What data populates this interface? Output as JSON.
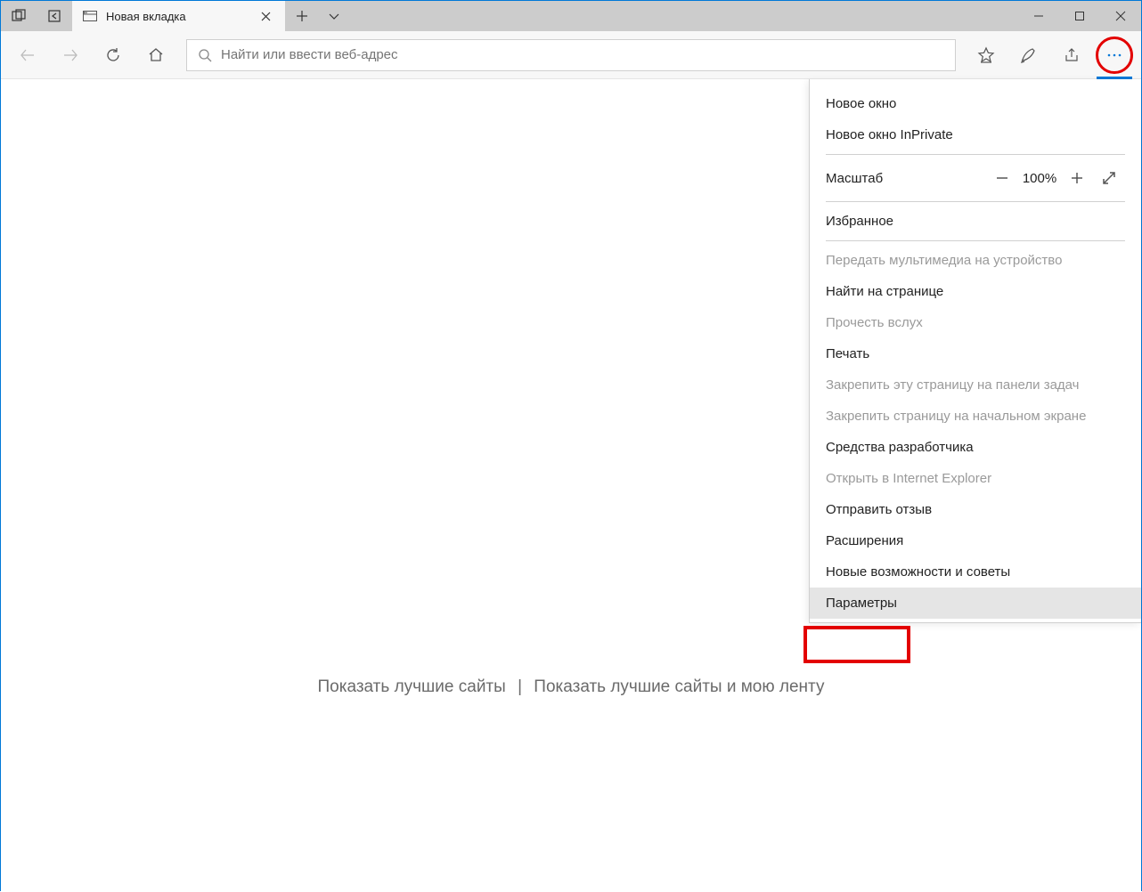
{
  "tab": {
    "title": "Новая вкладка"
  },
  "addressbar": {
    "placeholder": "Найти или ввести веб-адрес"
  },
  "page": {
    "show_top_sites": "Показать лучшие сайты",
    "separator": "|",
    "show_top_sites_and_feed": "Показать лучшие сайты и мою ленту"
  },
  "menu": {
    "new_window": "Новое окно",
    "new_inprivate": "Новое окно InPrivate",
    "zoom_label": "Масштаб",
    "zoom_value": "100%",
    "favorites": "Избранное",
    "cast": "Передать мультимедиа на устройство",
    "find": "Найти на странице",
    "read_aloud": "Прочесть вслух",
    "print": "Печать",
    "pin_taskbar": "Закрепить эту страницу на панели задач",
    "pin_start": "Закрепить страницу на начальном экране",
    "devtools": "Средства разработчика",
    "open_ie": "Открыть в Internet Explorer",
    "feedback": "Отправить отзыв",
    "extensions": "Расширения",
    "whats_new": "Новые возможности и советы",
    "settings": "Параметры"
  }
}
